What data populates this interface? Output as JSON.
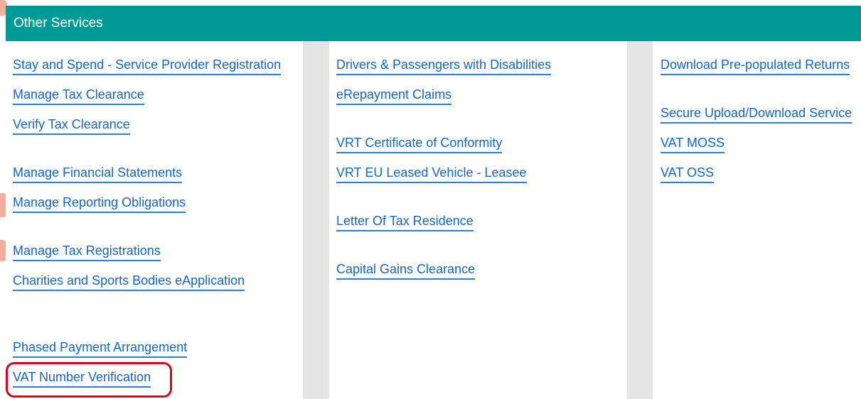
{
  "panel": {
    "title": "Other Services",
    "header_color": "#009b96",
    "link_color": "#1166c9",
    "highlight_color": "#e0001b"
  },
  "columns": [
    {
      "links": [
        "Stay and Spend - Service Provider Registration",
        "Manage Tax Clearance",
        "Verify Tax Clearance",
        "Manage Financial Statements",
        "Manage Reporting Obligations",
        "Manage Tax Registrations",
        "Charities and Sports Bodies eApplication",
        "Phased Payment Arrangement",
        "VAT Number Verification"
      ]
    },
    {
      "links": [
        "Drivers & Passengers with Disabilities",
        "eRepayment Claims",
        "VRT Certificate of Conformity",
        "VRT EU Leased Vehicle - Leasee",
        "Letter Of Tax Residence",
        "Capital Gains Clearance"
      ]
    },
    {
      "links": [
        "Download Pre-populated Returns",
        "Secure Upload/Download Service",
        "VAT MOSS",
        "VAT OSS"
      ]
    }
  ]
}
